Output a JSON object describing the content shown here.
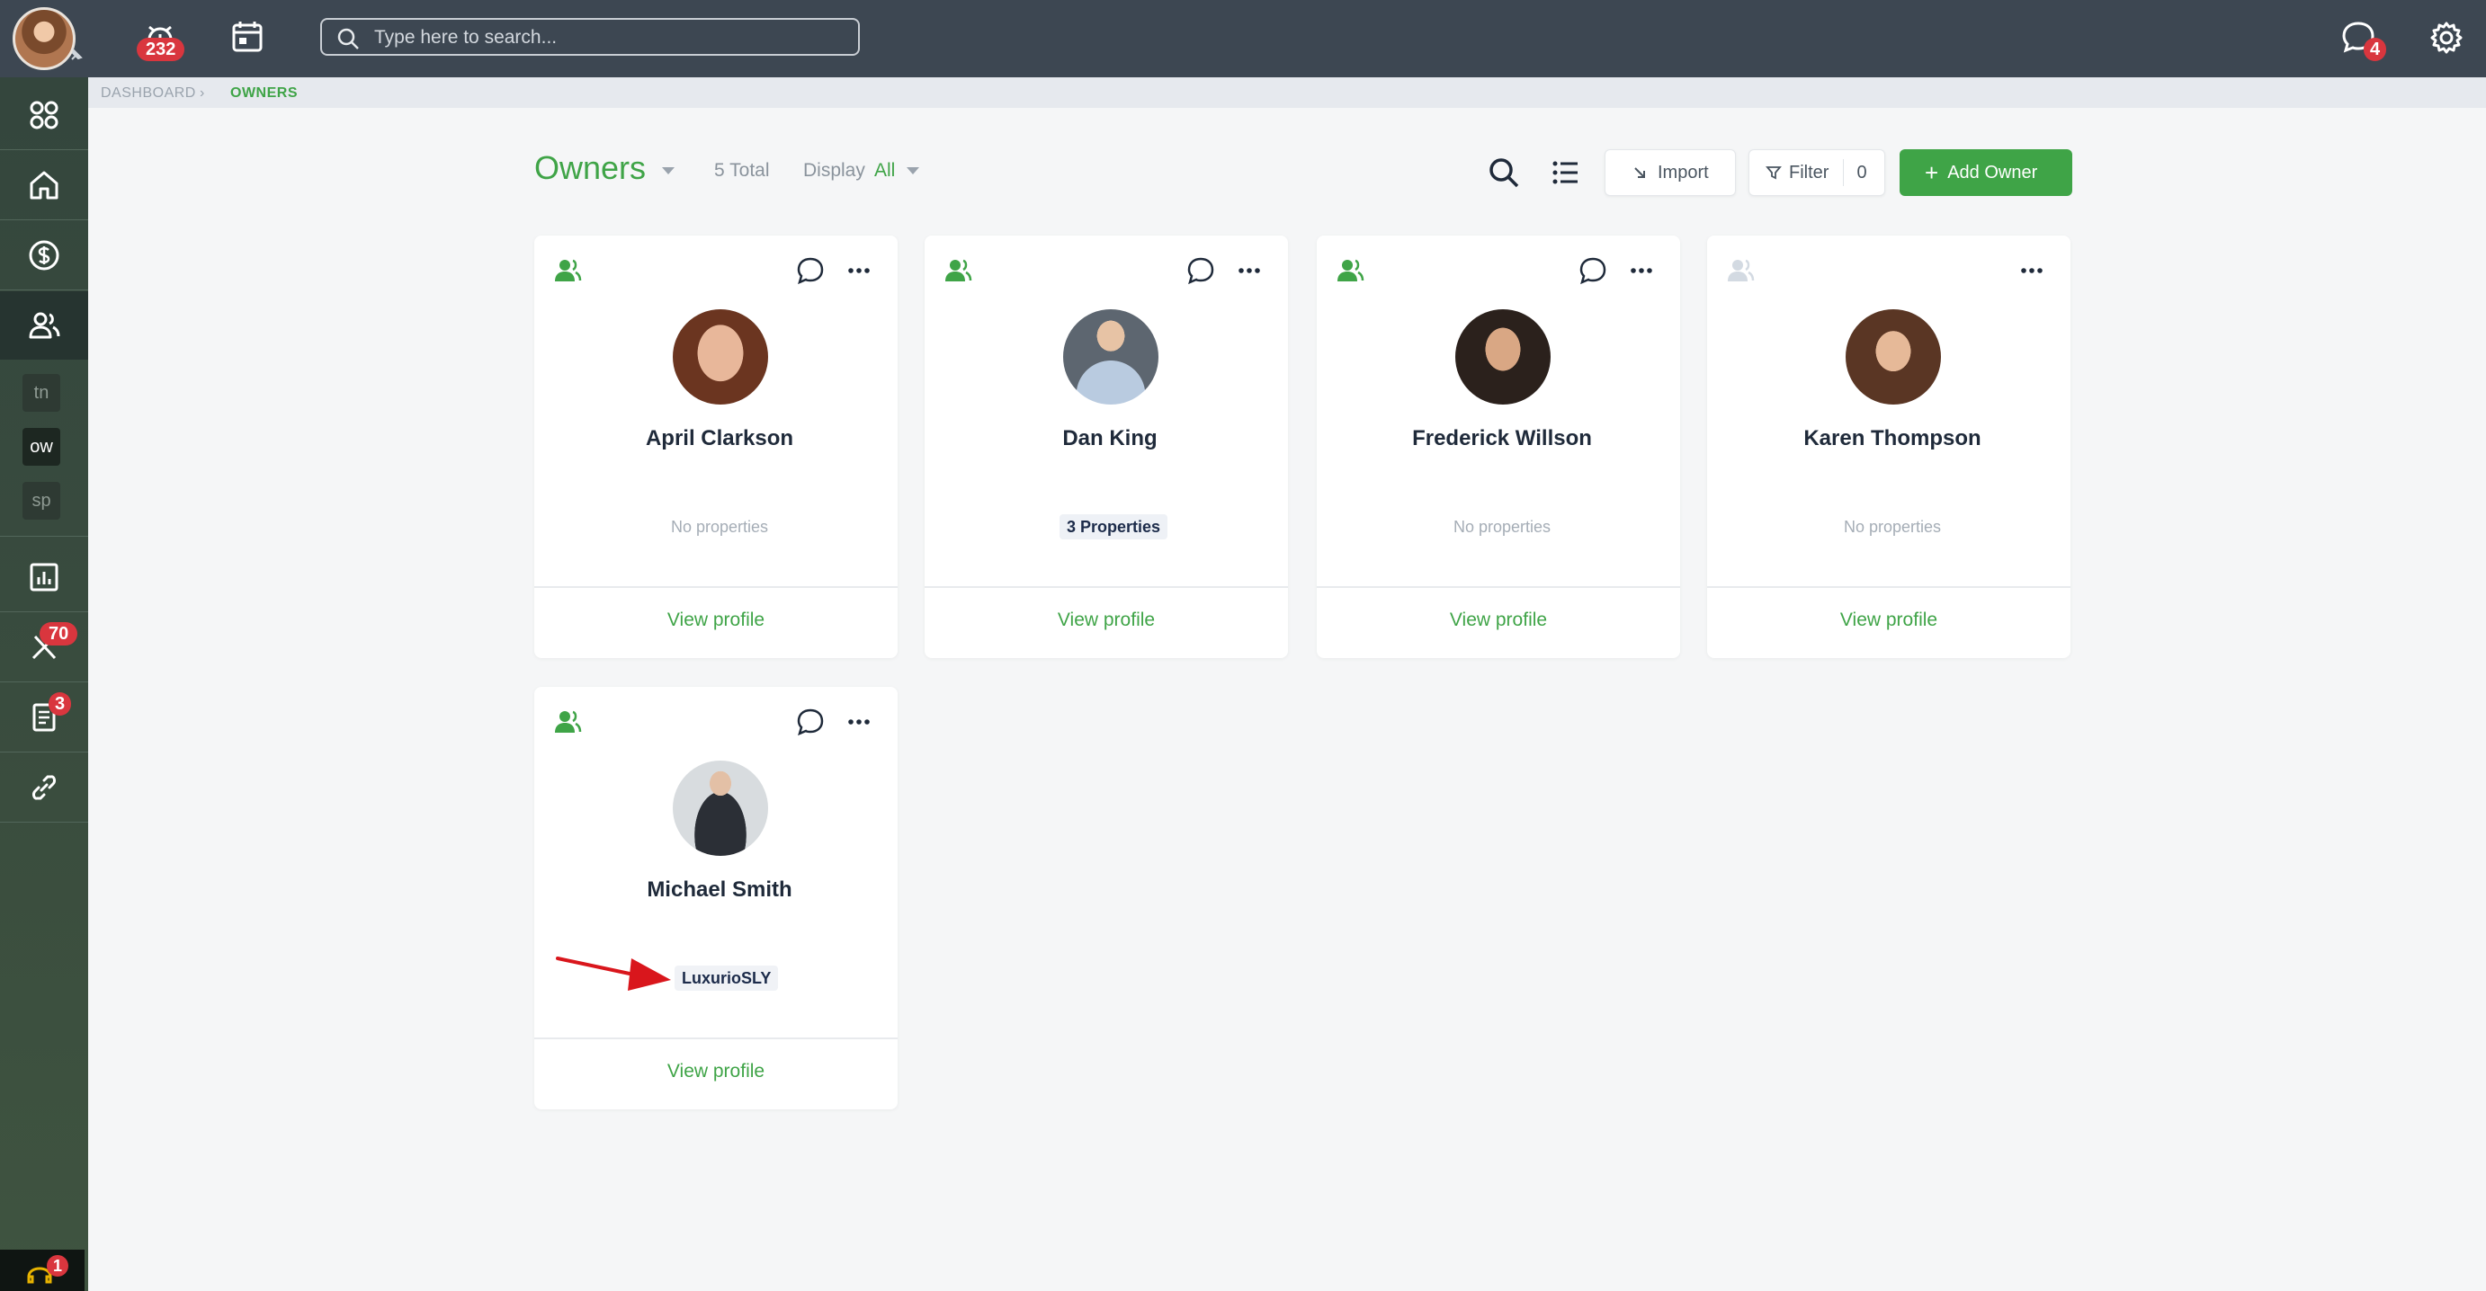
{
  "topbar": {
    "alerts_badge": "232",
    "messages_badge": "4",
    "search_placeholder": "Type here to search..."
  },
  "sidebar": {
    "abbr_items": [
      "tn",
      "ow",
      "sp"
    ],
    "maintenance_badge": "70",
    "documents_badge": "3",
    "support_badge": "1"
  },
  "breadcrumb": {
    "root": "DASHBOARD",
    "current": "OWNERS"
  },
  "header": {
    "title": "Owners",
    "total": "5 Total",
    "display_label": "Display",
    "display_value": "All",
    "import_label": "Import",
    "filter_label": "Filter",
    "filter_count": "0",
    "add_label": "Add Owner"
  },
  "owners": [
    {
      "name": "April Clarkson",
      "properties": "No properties",
      "view": "View profile",
      "has_chat": true,
      "active": true
    },
    {
      "name": "Dan King",
      "properties": "3 Properties",
      "view": "View profile",
      "has_chat": true,
      "active": true
    },
    {
      "name": "Frederick Willson",
      "properties": "No properties",
      "view": "View profile",
      "has_chat": true,
      "active": true
    },
    {
      "name": "Karen Thompson",
      "properties": "No properties",
      "view": "View profile",
      "has_chat": false,
      "active": false
    },
    {
      "name": "Michael Smith",
      "properties": "LuxurioSLY",
      "view": "View profile",
      "has_chat": true,
      "active": true
    }
  ],
  "colors": {
    "accent": "#3fa447",
    "topbar": "#3d4752",
    "badge": "#d9363e",
    "annotation_arrow": "#d9161c"
  }
}
